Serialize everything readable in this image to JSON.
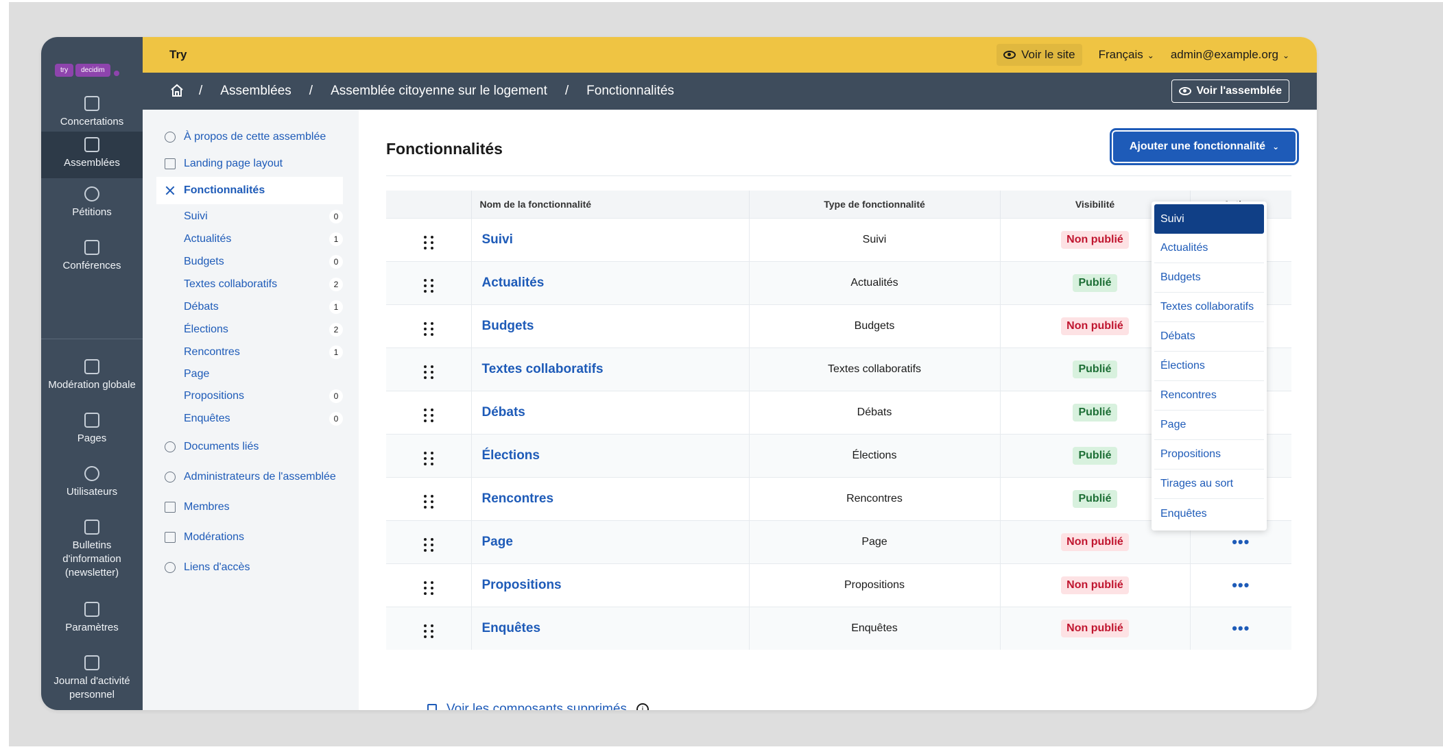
{
  "brand": {
    "logo_try": "try",
    "logo_decidim": "decidim",
    "org_name": "Try"
  },
  "topbar": {
    "see_site": "Voir le site",
    "language": "Français",
    "account": "admin@example.org"
  },
  "rail": {
    "items": [
      {
        "label": "Concertations"
      },
      {
        "label": "Assemblées"
      },
      {
        "label": "Pétitions"
      },
      {
        "label": "Conférences"
      },
      {
        "label": "Modération globale"
      },
      {
        "label": "Pages"
      },
      {
        "label": "Utilisateurs"
      },
      {
        "label": "Bulletins d'information (newsletter)"
      },
      {
        "label": "Paramètres"
      },
      {
        "label": "Journal d'activité personnel"
      }
    ]
  },
  "breadcrumb": {
    "items": [
      "Assemblées",
      "Assemblée citoyenne sur le logement",
      "Fonctionnalités"
    ],
    "separator": "/",
    "view_assembly": "Voir l'assemblée"
  },
  "subnav": {
    "about": "À propos de cette assemblée",
    "landing": "Landing page layout",
    "features": "Fonctionnalités",
    "components": [
      {
        "label": "Suivi",
        "count": "0"
      },
      {
        "label": "Actualités",
        "count": "1"
      },
      {
        "label": "Budgets",
        "count": "0"
      },
      {
        "label": "Textes collaboratifs",
        "count": "2"
      },
      {
        "label": "Débats",
        "count": "1"
      },
      {
        "label": "Élections",
        "count": "2"
      },
      {
        "label": "Rencontres",
        "count": "1"
      },
      {
        "label": "Page",
        "count": ""
      },
      {
        "label": "Propositions",
        "count": "0"
      },
      {
        "label": "Enquêtes",
        "count": "0"
      }
    ],
    "linked_docs": "Documents liés",
    "admins": "Administrateurs de l'assemblée",
    "members": "Membres",
    "moderations": "Modérations",
    "access_links": "Liens d'accès"
  },
  "main": {
    "title": "Fonctionnalités",
    "add_button": "Ajouter une fonctionnalité",
    "deleted_link": "Voir les composants supprimés"
  },
  "table": {
    "headers": [
      "Nom de la fonctionnalité",
      "Type de fonctionnalité",
      "Visibilité",
      "Actions"
    ],
    "rows": [
      {
        "name": "Suivi",
        "type": "Suivi",
        "status": "Non publié",
        "published": false
      },
      {
        "name": "Actualités",
        "type": "Actualités",
        "status": "Publié",
        "published": true
      },
      {
        "name": "Budgets",
        "type": "Budgets",
        "status": "Non publié",
        "published": false
      },
      {
        "name": "Textes collaboratifs",
        "type": "Textes collaboratifs",
        "status": "Publié",
        "published": true
      },
      {
        "name": "Débats",
        "type": "Débats",
        "status": "Publié",
        "published": true
      },
      {
        "name": "Élections",
        "type": "Élections",
        "status": "Publié",
        "published": true
      },
      {
        "name": "Rencontres",
        "type": "Rencontres",
        "status": "Publié",
        "published": true
      },
      {
        "name": "Page",
        "type": "Page",
        "status": "Non publié",
        "published": false
      },
      {
        "name": "Propositions",
        "type": "Propositions",
        "status": "Non publié",
        "published": false
      },
      {
        "name": "Enquêtes",
        "type": "Enquêtes",
        "status": "Non publié",
        "published": false
      }
    ],
    "actions_glyph": "•••"
  },
  "dropdown": {
    "items": [
      "Suivi",
      "Actualités",
      "Budgets",
      "Textes collaboratifs",
      "Débats",
      "Élections",
      "Rencontres",
      "Page",
      "Propositions",
      "Tirages au sort",
      "Enquêtes"
    ],
    "selected": "Suivi"
  },
  "colors": {
    "accent": "#1e5bb8",
    "topbar": "#efc443",
    "rail": "#3e4c5c",
    "published": "#1c6e35",
    "unpublished": "#c0152f"
  }
}
